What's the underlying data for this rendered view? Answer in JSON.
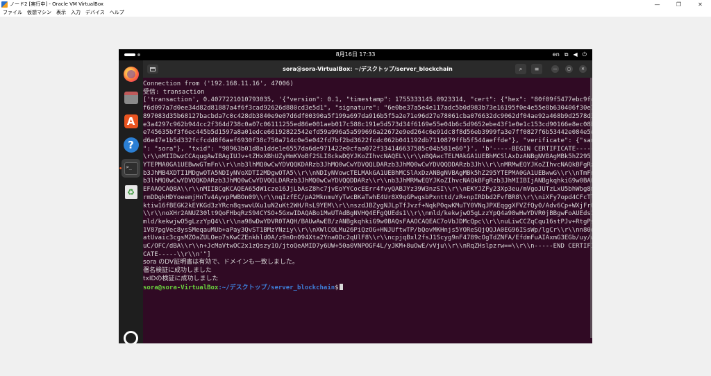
{
  "vbox": {
    "title": "ノード2 [実行中] - Oracle VM VirtualBox",
    "menu": [
      "ファイル",
      "仮想マシン",
      "表示",
      "入力",
      "デバイス",
      "ヘルプ"
    ],
    "controls": [
      "—",
      "❐",
      "✕"
    ]
  },
  "topbar": {
    "clock": "8月16日  17:33",
    "lang": "en"
  },
  "dock": {
    "items": [
      "firefox",
      "files",
      "app-center",
      "help",
      "terminal",
      "trash",
      "show-apps"
    ],
    "help_glyph": "?",
    "app_center_glyph": "A",
    "trash_glyph": "♻",
    "terminal_glyph": ">_"
  },
  "terminal": {
    "title": "sora@sora-VirtualBox: ~/デスクトップ/server_blockchain",
    "lines": [
      "Connection from ('192.168.11.16', 47006)",
      "受信: transaction",
      "['transaction', 0.4077221010793035, '{\"version\": 0.1, \"timestamp\": 1755333145.0923314, \"cert\": {\"hex\": \"80f09f5477ebc9f4",
      "f6d097a7d0ee34d82d81887a4f6f3cad92626d880cd3e5d1\", \"signature\": \"6e0be37a5e4e117adc5b0d983b73e16195f0e4e55e8b630406f30e7",
      "897083d35b68127bacbda7c0c428db3840e9e07d6df00390a5f199a697da916b5f5a2e71e96d27e78061cba076632dc9062df04ae92a468b9d2578d3",
      "e3a4297c962b944cc2f364d738c0a07c06111255ed86e001aeb017c588c191e5d573d34f6169e55e04b6c5d9652ebe43f1e0e1c153cd90166e8ec08b",
      "e745635bf3f6ec445b5d1597a8a01edce66192822542efd59a996a5a599696a22672e9ed264c6e91dc8f8d56eb3999fa3e7ff0827f6b53442e084e5e",
      "d6e47e1b5d332fcfcdd8f6aef6930f38c750a714c0e5e042fd7bf2bd3622fcdc062b041192db7110879ffb5f544aeffde\"}, \"verificate\": {\"san",
      "\": \"sora\"}, \"txid\": \"98963b01d8a1dde1e6557da6de971422e0cfaa072f334146637585c04b581e60\"}', 'b'-----BEGIN CERTIFICATE-----",
      "\\r\\\\nMIIDwzCCAqugAwIBAgIUJv+tZHxXBhUZyHmKVoBf2SLI8ckwDQYJKoZIhvcNAQEL\\\\r\\\\nBQAwcTELMAkGA1UEBhMCSlAxDzANBgNVBAgMBk5hZ295",
      "YTEPMA0GA1UEBwwGTmFn\\\\r\\\\nb3lhMQ0wCwYDVQQKDARzb3JhMQ0wCwYDVQQLDARzb3JhMQ0wCwYDVQQDDARzb3Jh\\\\r\\\\nMRMwEQYJKoZIhvcNAQkBFgRz",
      "b3JhMB4XDTI1MDgwOTA5NDIyNVoXDTI2MDgwOTA5\\\\r\\\\nNDIyNVowcTELMAkGA1UEBhMCSlAxDzANBgNVBAgMBk5hZ295YTEPMA0GA1UEBwwG\\\\r\\\\nTmFn",
      "b3lhMQ0wCwYDVQQKDARzb3JhMQ0wCwYDVQQLDARzb3JhMQ0wCwYDVQQDDARz\\\\r\\\\nb3JhMRMwEQYJKoZIhvcNAQkBFgRzb3JhMIIBIjANBgkqhkiG9w0BAQ",
      "EFAAOCAQ8A\\\\r\\\\nMIIBCgKCAQEA65dW1cze16JjLbAsZ8hc7jvEoYYCocEErr4fvyQABJYz39W3nzSI\\\\r\\\\nEKYJZFy23Xp3eu/mVgoJUTzLxU5bhWbg8m",
      "rmDDgkHDYoeemjHnTv4AyvpPWBOn09\\\\r\\\\nqIzfEC/pA2MknmuYyTwcBKaTwhE4Ur8X9qGPwgsbPxnttd/zR+npIRDbd2FvfBR8\\\\r\\\\niXFy7opd4CFcTl",
      "ktiw16fBEGK2kEYKGd3zYRcn8qswvUXu1uN2uKt2WH/RsL9YEM\\\\r\\\\nszdJBZygNJLpTfJvzf+NqkP0qwKMuTY0VNqJPXEqggXFVZfQy0/Adv6Cp+WXjFr0",
      "\\\\r\\\\noXHr2ANUZ30lt9QoFHbqRzS94CYSO+5GxwIDAQABo1MwUTAdBgNVHQ4EFgQUEds1\\\\r\\\\nmld/kekwjwO5gLzzYpQ4a98wHwYDVR0jBBgwFoAUEds1",
      "mld/kekwjwO5gLzzYpQ4\\\\r\\\\na98wDwYDVR0TAQH/BAUwAwEB/zANBgkqhkiG9w0BAQsFAAOCAQEAC7oVbJDMcQpc\\\\r\\\\nuLiwCCZqCqu16stPJv+RtgPs",
      "1V87pgVec8ysSMeqauMUb+aPay3QvST1BMzYNziy\\\\r\\\\nXWlCOLMu26PiQzOG+HNJUftwTP/bQovMKHnjs5YOReSQjQQJA0EG96ISsWp/lgCr\\\\r\\\\nn80et",
      "atUvaic3cgsMZOaZULOeo7sKwCZEnkhldOA/z9nOn094Xta2Yna0Dc2qUlF8\\\\r\\\\ncpjqBxl2fsJ1Scyg9nF4789cOgTdZNFA/EfdmFuAIAxmG3EGb/uy/w",
      "uC/OFC/dBA\\\\r\\\\n+JcMaVtwOC2x1zQszy1O/jtoQeAMID7y6UW+50a0VNPOGF4L/yJKM+8uOwE/vVju\\\\r\\\\nRqZHslpzrw==\\\\r\\\\n-----END CERTIFI",
      "CATE-----\\\\r\\\\n'\"]",
      "sora のDV証明書は有効で、ドメインも一致しました。",
      "署名検証に成功しました",
      "txIDの検証に成功しました"
    ],
    "prompt_user": "sora@sora-VirtualBox",
    "prompt_path": ":~/デスクトップ/server_blockchain",
    "prompt_symbol": "$"
  }
}
